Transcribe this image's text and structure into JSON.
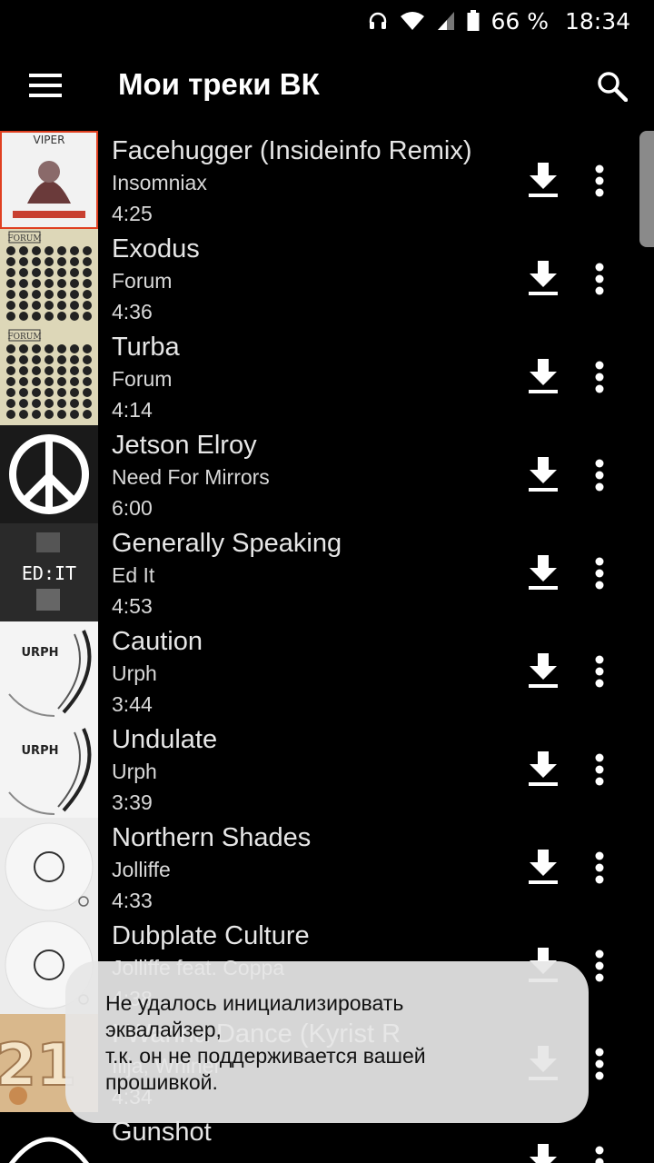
{
  "status_bar": {
    "battery": "66 %",
    "time": "18:34",
    "icons": [
      "headphones-icon",
      "wifi-icon",
      "cell-signal-icon",
      "battery-icon"
    ]
  },
  "app_bar": {
    "title": "Мои треки ВК",
    "menu_icon": "hamburger-menu-icon",
    "search_icon": "search-icon"
  },
  "tracks": [
    {
      "title": "Facehugger (Insideinfo Remix)",
      "artist": "Insomniax",
      "duration": "4:25",
      "cover_text": "VIPER"
    },
    {
      "title": "Exodus",
      "artist": "Forum",
      "duration": "4:36",
      "cover_text": "FORUM"
    },
    {
      "title": "Turba",
      "artist": "Forum",
      "duration": "4:14",
      "cover_text": "FORUM"
    },
    {
      "title": "Jetson Elroy",
      "artist": "Need For Mirrors",
      "duration": "6:00",
      "cover_text": ""
    },
    {
      "title": "Generally Speaking",
      "artist": "Ed It",
      "duration": "4:53",
      "cover_text": "ED:IT"
    },
    {
      "title": "Caution",
      "artist": "Urph",
      "duration": "3:44",
      "cover_text": "URPH"
    },
    {
      "title": "Undulate",
      "artist": "Urph",
      "duration": "3:39",
      "cover_text": "URPH"
    },
    {
      "title": "Northern Shades",
      "artist": "Jolliffe",
      "duration": "4:33",
      "cover_text": ""
    },
    {
      "title": "Dubplate Culture",
      "artist": "Jolliffe feat. Coppa",
      "duration": "4:38",
      "cover_text": ""
    },
    {
      "title": "I Wanna Dance (Kyrist R",
      "artist": "Ilija, Whiner",
      "duration": "4:34",
      "cover_text": "21"
    },
    {
      "title": "Gunshot",
      "artist": "",
      "duration": "",
      "cover_text": ""
    }
  ],
  "toast": {
    "line1": "Не удалось инициализировать",
    "line2": "эквалайзер,",
    "line3": "т.к. он не поддерживается вашей",
    "line4": "прошивкой."
  },
  "colors": {
    "background": "#000000",
    "text_primary": "#e6e6e6",
    "toast_bg": "#e6e6e6"
  }
}
